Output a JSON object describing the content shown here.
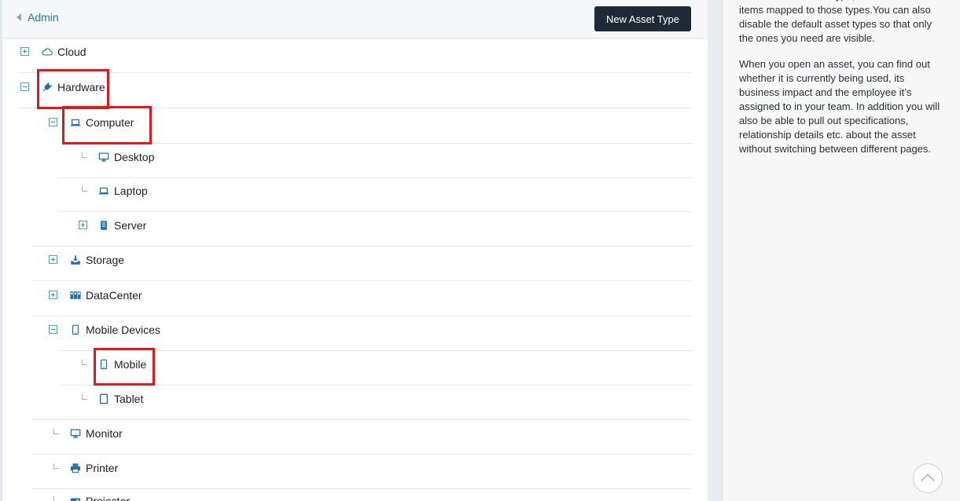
{
  "header": {
    "back_label": "Admin",
    "new_button_label": "New Asset Type"
  },
  "tree": {
    "cloud": "Cloud",
    "hardware": "Hardware",
    "computer": "Computer",
    "desktop": "Desktop",
    "laptop": "Laptop",
    "server": "Server",
    "storage": "Storage",
    "datacenter": "DataCenter",
    "mobile_devices": "Mobile Devices",
    "mobile": "Mobile",
    "tablet": "Tablet",
    "monitor": "Monitor",
    "printer": "Printer",
    "projector": "Projector"
  },
  "sidebar": {
    "paragraph_1": "within another asset type, and have several items mapped to those types.You can also disable the default asset types so that only the ones you need are visible.",
    "paragraph_2": "When you open an asset, you can find out whether it is currently being used, its business impact and the employee it’s assigned to in your team. In addition you will also be able to pull out specifications, relationship details etc. about the asset without switching between different pages."
  },
  "colors": {
    "accent": "#1a73c8",
    "icon_blue": "#1c6fb5",
    "highlight": "#e0181b",
    "button_dark": "#1e2a36"
  }
}
